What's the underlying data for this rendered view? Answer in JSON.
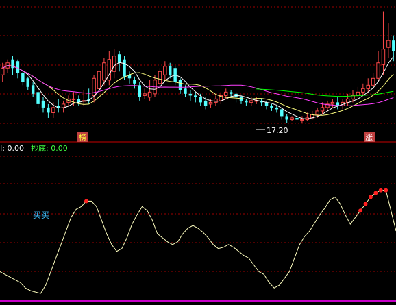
{
  "colors": {
    "background": "#000000",
    "up_candle": "#ff4a4a",
    "down_candle": "#54ffff",
    "ma_short": "#ffffff",
    "ma_mid": "#ffff80",
    "ma_long": "#ff40ff",
    "ma_longest": "#00ff00",
    "separator": "#c80000",
    "grid": "#a00000",
    "indicator_line": "#ffffc0",
    "signal_dot": "#ff2020",
    "signal_text": "#40c0ff",
    "header_green": "#40ff40"
  },
  "header": {
    "value_label": "I: 0.00",
    "bottom_label": "抄底: 0.00"
  },
  "price_panel": {
    "low_annotation": "17.20",
    "marker_left": "榜",
    "marker_right": "涨"
  },
  "indicator_panel": {
    "signal_text": "买买"
  },
  "chart_data": [
    {
      "type": "candlestick",
      "candles": [
        {
          "o": 88,
          "c": 92,
          "h": 95,
          "l": 84
        },
        {
          "o": 92,
          "c": 95,
          "h": 97,
          "l": 89
        },
        {
          "o": 97,
          "c": 92,
          "h": 99,
          "l": 88
        },
        {
          "o": 96,
          "c": 89,
          "h": 97,
          "l": 86
        },
        {
          "o": 89,
          "c": 84,
          "h": 90,
          "l": 82
        },
        {
          "o": 86,
          "c": 81,
          "h": 87,
          "l": 79
        },
        {
          "o": 82,
          "c": 77,
          "h": 84,
          "l": 75
        },
        {
          "o": 78,
          "c": 71,
          "h": 79,
          "l": 69
        },
        {
          "o": 73,
          "c": 69,
          "h": 75,
          "l": 66
        },
        {
          "o": 69,
          "c": 66,
          "h": 71,
          "l": 63
        },
        {
          "o": 66,
          "c": 69,
          "h": 72,
          "l": 63
        },
        {
          "o": 70,
          "c": 69,
          "h": 74,
          "l": 66
        },
        {
          "o": 69,
          "c": 71,
          "h": 73,
          "l": 66
        },
        {
          "o": 72,
          "c": 74,
          "h": 76,
          "l": 70
        },
        {
          "o": 74,
          "c": 74,
          "h": 78,
          "l": 70
        },
        {
          "o": 74,
          "c": 72,
          "h": 76,
          "l": 70
        },
        {
          "o": 73,
          "c": 73,
          "h": 79,
          "l": 70
        },
        {
          "o": 74,
          "c": 73,
          "h": 80,
          "l": 71
        },
        {
          "o": 76,
          "c": 86,
          "h": 88,
          "l": 72
        },
        {
          "o": 80,
          "c": 90,
          "h": 94,
          "l": 76
        },
        {
          "o": 85,
          "c": 95,
          "h": 98,
          "l": 82
        },
        {
          "o": 85,
          "c": 97,
          "h": 102,
          "l": 82
        },
        {
          "o": 90,
          "c": 99,
          "h": 103,
          "l": 86
        },
        {
          "o": 100,
          "c": 95,
          "h": 102,
          "l": 90
        },
        {
          "o": 97,
          "c": 87,
          "h": 99,
          "l": 85
        },
        {
          "o": 88,
          "c": 86,
          "h": 90,
          "l": 83
        },
        {
          "o": 85,
          "c": 83,
          "h": 87,
          "l": 80
        },
        {
          "o": 82,
          "c": 75,
          "h": 84,
          "l": 73
        },
        {
          "o": 76,
          "c": 77,
          "h": 80,
          "l": 74
        },
        {
          "o": 75,
          "c": 78,
          "h": 85,
          "l": 73
        },
        {
          "o": 77,
          "c": 85,
          "h": 88,
          "l": 75
        },
        {
          "o": 83,
          "c": 90,
          "h": 92,
          "l": 80
        },
        {
          "o": 88,
          "c": 93,
          "h": 96,
          "l": 85
        },
        {
          "o": 93,
          "c": 88,
          "h": 95,
          "l": 86
        },
        {
          "o": 92,
          "c": 84,
          "h": 93,
          "l": 82
        },
        {
          "o": 85,
          "c": 79,
          "h": 86,
          "l": 77
        },
        {
          "o": 80,
          "c": 77,
          "h": 82,
          "l": 75
        },
        {
          "o": 77,
          "c": 76,
          "h": 79,
          "l": 73
        },
        {
          "o": 76,
          "c": 75,
          "h": 78,
          "l": 72
        },
        {
          "o": 75,
          "c": 72,
          "h": 77,
          "l": 70
        },
        {
          "o": 73,
          "c": 70,
          "h": 75,
          "l": 68
        },
        {
          "o": 71,
          "c": 72,
          "h": 74,
          "l": 69
        },
        {
          "o": 72,
          "c": 74,
          "h": 76,
          "l": 70
        },
        {
          "o": 73,
          "c": 76,
          "h": 78,
          "l": 71
        },
        {
          "o": 76,
          "c": 78,
          "h": 80,
          "l": 74
        },
        {
          "o": 78,
          "c": 77,
          "h": 79,
          "l": 75
        },
        {
          "o": 77,
          "c": 75,
          "h": 78,
          "l": 72
        },
        {
          "o": 75,
          "c": 73,
          "h": 76,
          "l": 71
        },
        {
          "o": 73,
          "c": 72,
          "h": 74,
          "l": 70
        },
        {
          "o": 72,
          "c": 73,
          "h": 75,
          "l": 70
        },
        {
          "o": 73,
          "c": 73,
          "h": 75,
          "l": 71
        },
        {
          "o": 73,
          "c": 72,
          "h": 74,
          "l": 70
        },
        {
          "o": 72,
          "c": 70,
          "h": 73,
          "l": 68
        },
        {
          "o": 70,
          "c": 69,
          "h": 71,
          "l": 67
        },
        {
          "o": 69,
          "c": 68,
          "h": 70,
          "l": 66
        },
        {
          "o": 68,
          "c": 64,
          "h": 69,
          "l": 62
        },
        {
          "o": 64,
          "c": 62,
          "h": 65,
          "l": 60
        },
        {
          "o": 62,
          "c": 63,
          "h": 64,
          "l": 61
        },
        {
          "o": 63,
          "c": 62,
          "h": 65,
          "l": 60
        },
        {
          "o": 62,
          "c": 62,
          "h": 64,
          "l": 60
        },
        {
          "o": 62,
          "c": 63,
          "h": 66,
          "l": 61
        },
        {
          "o": 63,
          "c": 65,
          "h": 67,
          "l": 62
        },
        {
          "o": 65,
          "c": 67,
          "h": 69,
          "l": 63
        },
        {
          "o": 67,
          "c": 69,
          "h": 72,
          "l": 65
        },
        {
          "o": 69,
          "c": 71,
          "h": 73,
          "l": 67
        },
        {
          "o": 71,
          "c": 72,
          "h": 74,
          "l": 69
        },
        {
          "o": 72,
          "c": 70,
          "h": 75,
          "l": 68
        },
        {
          "o": 70,
          "c": 72,
          "h": 74,
          "l": 68
        },
        {
          "o": 72,
          "c": 74,
          "h": 77,
          "l": 70
        },
        {
          "o": 74,
          "c": 76,
          "h": 79,
          "l": 72
        },
        {
          "o": 76,
          "c": 78,
          "h": 81,
          "l": 74
        },
        {
          "o": 78,
          "c": 80,
          "h": 83,
          "l": 76
        },
        {
          "o": 80,
          "c": 82,
          "h": 86,
          "l": 78
        },
        {
          "o": 82,
          "c": 86,
          "h": 89,
          "l": 80
        },
        {
          "o": 86,
          "c": 95,
          "h": 102,
          "l": 84
        },
        {
          "o": 94,
          "c": 103,
          "h": 125,
          "l": 88
        },
        {
          "o": 104,
          "c": 108,
          "h": 118,
          "l": 98
        },
        {
          "o": 108,
          "c": 102,
          "h": 111,
          "l": 96
        }
      ],
      "ylim": [
        55,
        130
      ],
      "moving_averages": [
        {
          "color": "ma_short",
          "period": 5
        },
        {
          "color": "ma_mid",
          "period": 10
        },
        {
          "color": "ma_long",
          "period": 30
        },
        {
          "color": "ma_longest",
          "period": 60
        }
      ]
    },
    {
      "type": "line",
      "ylim": [
        0,
        100
      ],
      "values": [
        20,
        18,
        16,
        14,
        12,
        8,
        6,
        5,
        4,
        10,
        20,
        30,
        40,
        50,
        60,
        66,
        68,
        72,
        72,
        68,
        58,
        48,
        40,
        35,
        37,
        45,
        55,
        62,
        68,
        65,
        58,
        48,
        45,
        42,
        40,
        42,
        48,
        52,
        54,
        52,
        49,
        45,
        40,
        37,
        38,
        40,
        38,
        35,
        32,
        30,
        25,
        20,
        18,
        12,
        8,
        10,
        15,
        20,
        30,
        40,
        46,
        50,
        56,
        62,
        67,
        73,
        75,
        70,
        62,
        55,
        60,
        65,
        70,
        75,
        78,
        80,
        80,
        65,
        50
      ],
      "signal_points": [
        17,
        71,
        72,
        73,
        74,
        75,
        76
      ]
    }
  ]
}
